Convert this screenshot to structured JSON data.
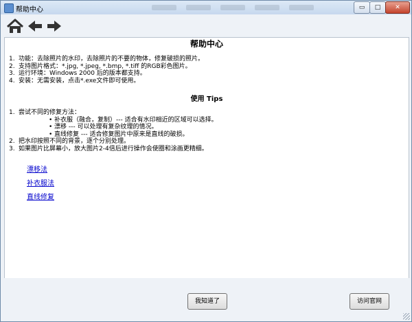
{
  "window": {
    "title": "帮助中心",
    "caption": {
      "minimize": "▭",
      "maximize": "□",
      "close": "✕"
    }
  },
  "toolbar": {
    "home_icon": "home-icon",
    "back_icon": "arrow-left-icon",
    "forward_icon": "arrow-right-icon"
  },
  "content": {
    "title": "帮助中心",
    "intro": [
      {
        "n": "1.",
        "text": "功能：去除照片的水印，去除照片的不要的物体，修复破损的照片。"
      },
      {
        "n": "2.",
        "text": "支持图片格式：*.jpg, *.jpeg, *.bmp, *.tiff 的RGB彩色图片。"
      },
      {
        "n": "3.",
        "text": "运行环境：Windows 2000 后的版本都支持。"
      },
      {
        "n": "4.",
        "text": "安装：无需安装，点击*.exe文件即可使用。"
      }
    ],
    "tips_heading": "使用 Tips",
    "tips": {
      "item1": "尝试不同的修复方法：",
      "sub": [
        "补衣服（融合，复制）--- 适合有水印相近的区域可以选择。",
        "漂移 --- 可以处理有复杂纹理的情况。",
        "直线修复 --- 适合修复图片中原来是直线的破损。"
      ],
      "item2": "把水印按照不同的背景，逐个分别处理。",
      "item3": "如果图片比屏幕小，放大图片2-4倍后进行操作会使圈和涂画更精细。"
    },
    "links": [
      "漂移法",
      "补衣服法",
      "直线修复"
    ]
  },
  "footer": {
    "ok_label": "我知道了",
    "site_label": "访问官网"
  }
}
